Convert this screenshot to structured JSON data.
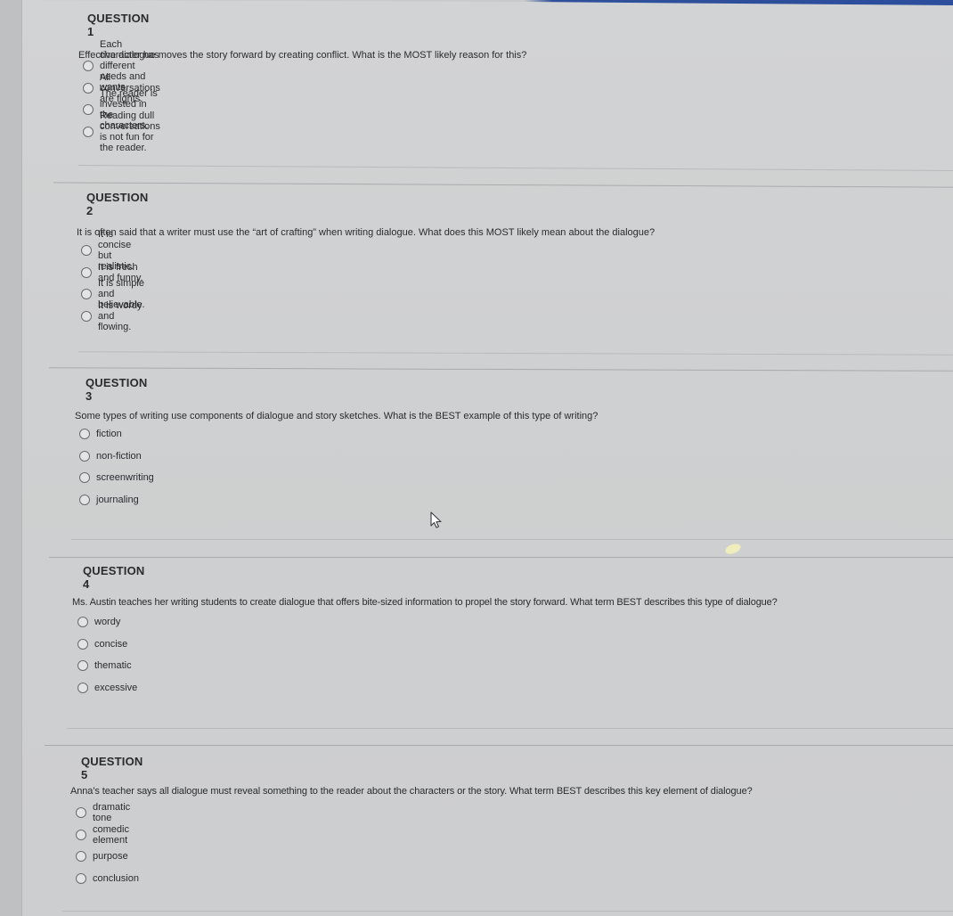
{
  "questions": [
    {
      "title": "QUESTION 1",
      "text": "Effective dialogue moves the story forward by creating conflict. What is the MOST likely reason for this?",
      "options": [
        "Each character has different needs and wants.",
        "All conversations are fights.",
        "The reader is invested in the characters.",
        "Reading dull conversations is not fun for the reader."
      ]
    },
    {
      "title": "QUESTION 2",
      "text": "It is often said that a writer must use the “art of crafting” when writing dialogue. What does this MOST likely mean about the dialogue?",
      "options": [
        "It is concise but realistic.",
        "It is fresh and funny.",
        "It is simple and believable.",
        "It is wordy and flowing."
      ]
    },
    {
      "title": "QUESTION 3",
      "text": "Some types of writing use components of dialogue and story sketches. What is the BEST example of this type of writing?",
      "options": [
        "fiction",
        "non-fiction",
        "screenwriting",
        "journaling"
      ]
    },
    {
      "title": "QUESTION 4",
      "text": "Ms. Austin teaches her writing students to create dialogue that offers bite-sized information to propel the story forward. What term BEST describes this type of dialogue?",
      "options": [
        "wordy",
        "concise",
        "thematic",
        "excessive"
      ]
    },
    {
      "title": "QUESTION 5",
      "text": "Anna’s teacher says all dialogue must reveal something to the reader about the characters or the story. What term BEST describes this key element of dialogue?",
      "options": [
        "dramatic tone",
        "comedic element",
        "purpose",
        "conclusion"
      ]
    }
  ],
  "colors": {
    "accent_bar": "#2c4e9c",
    "page_background": "#cfd0d1",
    "text": "#2a2b2f"
  },
  "icons": {
    "radio": "radio-button-unselected-icon",
    "cursor": "mouse-pointer-icon"
  }
}
